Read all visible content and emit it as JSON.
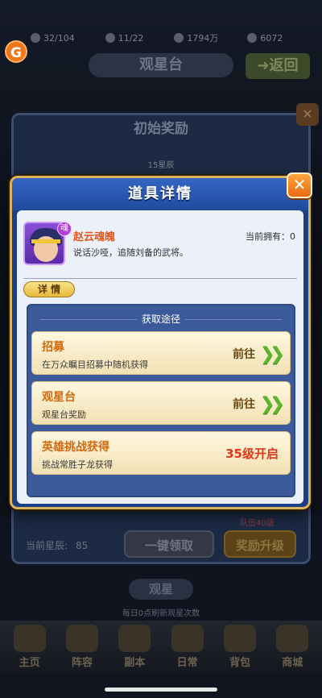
{
  "topbar": {
    "stamina": "32/104",
    "slots": "11/22",
    "coins": "1794万",
    "gems": "6072"
  },
  "background": {
    "page_title": "观星台",
    "back_label": "返回",
    "panel_title": "初始奖励",
    "star_label": "15星辰",
    "quota_text": "队伍40级",
    "current_star_label": "当前星辰:",
    "current_star_value": "85",
    "claim_all_label": "一键领取",
    "upgrade_label": "奖励升级",
    "star_tab_label": "观星",
    "refresh_text": "每日0点刷新观星次数"
  },
  "navbar": {
    "items": [
      {
        "label": "主页"
      },
      {
        "label": "阵容"
      },
      {
        "label": "副本"
      },
      {
        "label": "日常"
      },
      {
        "label": "背包"
      },
      {
        "label": "商城"
      }
    ]
  },
  "modal": {
    "title": "道具详情",
    "close_label": "✕",
    "item": {
      "name": "赵云魂魄",
      "badge": "魂",
      "description": "说话沙哑，追随刘备的武将。",
      "owned": "当前拥有：0"
    },
    "detail_tab": "详 情",
    "source_header": "获取途径",
    "sources": [
      {
        "title": "招募",
        "subtitle": "在万众瞩目招募中随机获得",
        "action": "前往"
      },
      {
        "title": "观星台",
        "subtitle": "观星台奖励",
        "action": "前往"
      },
      {
        "title": "英雄挑战获得",
        "subtitle": "挑战常胜子龙获得",
        "status": "35级开启"
      }
    ]
  }
}
